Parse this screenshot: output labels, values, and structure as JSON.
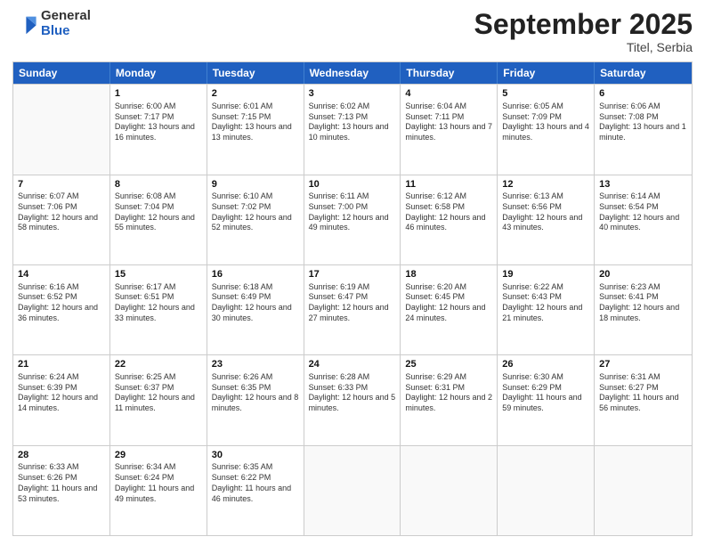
{
  "header": {
    "logo": {
      "general": "General",
      "blue": "Blue"
    },
    "title": "September 2025",
    "subtitle": "Titel, Serbia"
  },
  "weekdays": [
    "Sunday",
    "Monday",
    "Tuesday",
    "Wednesday",
    "Thursday",
    "Friday",
    "Saturday"
  ],
  "rows": [
    [
      {
        "day": "",
        "empty": true
      },
      {
        "day": "1",
        "sunrise": "Sunrise: 6:00 AM",
        "sunset": "Sunset: 7:17 PM",
        "daylight": "Daylight: 13 hours and 16 minutes."
      },
      {
        "day": "2",
        "sunrise": "Sunrise: 6:01 AM",
        "sunset": "Sunset: 7:15 PM",
        "daylight": "Daylight: 13 hours and 13 minutes."
      },
      {
        "day": "3",
        "sunrise": "Sunrise: 6:02 AM",
        "sunset": "Sunset: 7:13 PM",
        "daylight": "Daylight: 13 hours and 10 minutes."
      },
      {
        "day": "4",
        "sunrise": "Sunrise: 6:04 AM",
        "sunset": "Sunset: 7:11 PM",
        "daylight": "Daylight: 13 hours and 7 minutes."
      },
      {
        "day": "5",
        "sunrise": "Sunrise: 6:05 AM",
        "sunset": "Sunset: 7:09 PM",
        "daylight": "Daylight: 13 hours and 4 minutes."
      },
      {
        "day": "6",
        "sunrise": "Sunrise: 6:06 AM",
        "sunset": "Sunset: 7:08 PM",
        "daylight": "Daylight: 13 hours and 1 minute."
      }
    ],
    [
      {
        "day": "7",
        "sunrise": "Sunrise: 6:07 AM",
        "sunset": "Sunset: 7:06 PM",
        "daylight": "Daylight: 12 hours and 58 minutes."
      },
      {
        "day": "8",
        "sunrise": "Sunrise: 6:08 AM",
        "sunset": "Sunset: 7:04 PM",
        "daylight": "Daylight: 12 hours and 55 minutes."
      },
      {
        "day": "9",
        "sunrise": "Sunrise: 6:10 AM",
        "sunset": "Sunset: 7:02 PM",
        "daylight": "Daylight: 12 hours and 52 minutes."
      },
      {
        "day": "10",
        "sunrise": "Sunrise: 6:11 AM",
        "sunset": "Sunset: 7:00 PM",
        "daylight": "Daylight: 12 hours and 49 minutes."
      },
      {
        "day": "11",
        "sunrise": "Sunrise: 6:12 AM",
        "sunset": "Sunset: 6:58 PM",
        "daylight": "Daylight: 12 hours and 46 minutes."
      },
      {
        "day": "12",
        "sunrise": "Sunrise: 6:13 AM",
        "sunset": "Sunset: 6:56 PM",
        "daylight": "Daylight: 12 hours and 43 minutes."
      },
      {
        "day": "13",
        "sunrise": "Sunrise: 6:14 AM",
        "sunset": "Sunset: 6:54 PM",
        "daylight": "Daylight: 12 hours and 40 minutes."
      }
    ],
    [
      {
        "day": "14",
        "sunrise": "Sunrise: 6:16 AM",
        "sunset": "Sunset: 6:52 PM",
        "daylight": "Daylight: 12 hours and 36 minutes."
      },
      {
        "day": "15",
        "sunrise": "Sunrise: 6:17 AM",
        "sunset": "Sunset: 6:51 PM",
        "daylight": "Daylight: 12 hours and 33 minutes."
      },
      {
        "day": "16",
        "sunrise": "Sunrise: 6:18 AM",
        "sunset": "Sunset: 6:49 PM",
        "daylight": "Daylight: 12 hours and 30 minutes."
      },
      {
        "day": "17",
        "sunrise": "Sunrise: 6:19 AM",
        "sunset": "Sunset: 6:47 PM",
        "daylight": "Daylight: 12 hours and 27 minutes."
      },
      {
        "day": "18",
        "sunrise": "Sunrise: 6:20 AM",
        "sunset": "Sunset: 6:45 PM",
        "daylight": "Daylight: 12 hours and 24 minutes."
      },
      {
        "day": "19",
        "sunrise": "Sunrise: 6:22 AM",
        "sunset": "Sunset: 6:43 PM",
        "daylight": "Daylight: 12 hours and 21 minutes."
      },
      {
        "day": "20",
        "sunrise": "Sunrise: 6:23 AM",
        "sunset": "Sunset: 6:41 PM",
        "daylight": "Daylight: 12 hours and 18 minutes."
      }
    ],
    [
      {
        "day": "21",
        "sunrise": "Sunrise: 6:24 AM",
        "sunset": "Sunset: 6:39 PM",
        "daylight": "Daylight: 12 hours and 14 minutes."
      },
      {
        "day": "22",
        "sunrise": "Sunrise: 6:25 AM",
        "sunset": "Sunset: 6:37 PM",
        "daylight": "Daylight: 12 hours and 11 minutes."
      },
      {
        "day": "23",
        "sunrise": "Sunrise: 6:26 AM",
        "sunset": "Sunset: 6:35 PM",
        "daylight": "Daylight: 12 hours and 8 minutes."
      },
      {
        "day": "24",
        "sunrise": "Sunrise: 6:28 AM",
        "sunset": "Sunset: 6:33 PM",
        "daylight": "Daylight: 12 hours and 5 minutes."
      },
      {
        "day": "25",
        "sunrise": "Sunrise: 6:29 AM",
        "sunset": "Sunset: 6:31 PM",
        "daylight": "Daylight: 12 hours and 2 minutes."
      },
      {
        "day": "26",
        "sunrise": "Sunrise: 6:30 AM",
        "sunset": "Sunset: 6:29 PM",
        "daylight": "Daylight: 11 hours and 59 minutes."
      },
      {
        "day": "27",
        "sunrise": "Sunrise: 6:31 AM",
        "sunset": "Sunset: 6:27 PM",
        "daylight": "Daylight: 11 hours and 56 minutes."
      }
    ],
    [
      {
        "day": "28",
        "sunrise": "Sunrise: 6:33 AM",
        "sunset": "Sunset: 6:26 PM",
        "daylight": "Daylight: 11 hours and 53 minutes."
      },
      {
        "day": "29",
        "sunrise": "Sunrise: 6:34 AM",
        "sunset": "Sunset: 6:24 PM",
        "daylight": "Daylight: 11 hours and 49 minutes."
      },
      {
        "day": "30",
        "sunrise": "Sunrise: 6:35 AM",
        "sunset": "Sunset: 6:22 PM",
        "daylight": "Daylight: 11 hours and 46 minutes."
      },
      {
        "day": "",
        "empty": true
      },
      {
        "day": "",
        "empty": true
      },
      {
        "day": "",
        "empty": true
      },
      {
        "day": "",
        "empty": true
      }
    ]
  ]
}
